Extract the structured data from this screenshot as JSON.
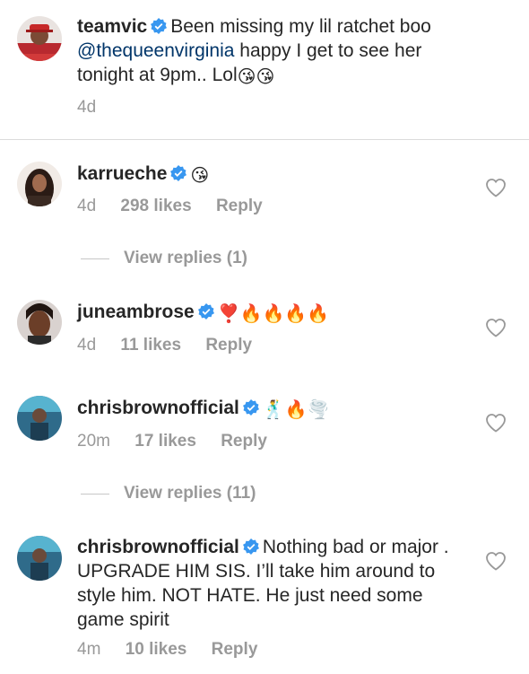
{
  "caption": {
    "username": "teamvic",
    "text_before": "Been missing my lil ratchet boo ",
    "mention": "@thequeenvirginia",
    "text_after": " happy I get to see her tonight at 9pm.. Lol",
    "emojis": "😘😘",
    "time": "4d"
  },
  "comments": [
    {
      "username": "karrueche",
      "text": "",
      "emojis": "😘",
      "time": "4d",
      "likes": "298 likes",
      "reply": "Reply"
    },
    {
      "username": "juneambrose",
      "text": "",
      "emojis": "❣️🔥🔥🔥🔥",
      "time": "4d",
      "likes": "11 likes",
      "reply": "Reply"
    },
    {
      "username": "chrisbrownofficial",
      "text": "",
      "emojis": "🕺🔥🌪️",
      "time": "20m",
      "likes": "17 likes",
      "reply": "Reply"
    },
    {
      "username": "chrisbrownofficial",
      "text": "Nothing bad or major . UPGRADE HIM SIS. I’ll take him around to style him. NOT HATE. He just need some game spirit",
      "emojis": "",
      "time": "4m",
      "likes": "10 likes",
      "reply": "Reply"
    }
  ],
  "view_replies": [
    "View replies (1)",
    "View replies (11)"
  ],
  "icons": {
    "verified": "verified-badge-icon",
    "heart": "heart-outline-icon"
  },
  "colors": {
    "verified": "#3897f0",
    "mention": "#003569",
    "meta": "#999999",
    "text": "#262626"
  }
}
